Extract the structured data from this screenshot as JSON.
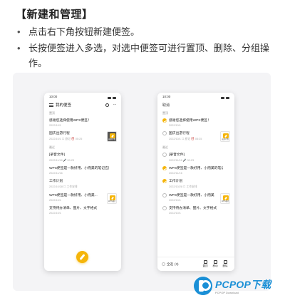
{
  "heading": "【新建和管理】",
  "bullets": [
    "点击右下角按钮新建便签。",
    "长按便签进入多选，对选中便签可进行置顶、删除、分组操作。"
  ],
  "phone_left": {
    "time": "10:00",
    "title": "我的便签",
    "sections": [
      "置顶",
      "最近"
    ],
    "notes": [
      {
        "title": "感谢您选择使用WPS便签！",
        "meta": "2022/10/1"
      },
      {
        "title": "国庆出游行程",
        "meta": "2022/10/1  ☐ 旅记  ⏰ 05:25",
        "thumb": "出游行程"
      },
      {
        "title": "[录音文件]",
        "meta": "2022/11/16  🎤 00:23"
      },
      {
        "title": "WPS便签是一款好用、小而美的笔记应用",
        "meta": "2022/11/16"
      },
      {
        "title": "工作计划",
        "meta": "2022/10/28  ☐ 工作安排"
      },
      {
        "title": "WPS便签是一款好用、小而美...",
        "meta": "2022/10/1",
        "thumb": "WPS便签"
      },
      {
        "title": "支持待办清单、图片、文字格式",
        "meta": "2022/10/1"
      }
    ]
  },
  "phone_right": {
    "time": "10:00",
    "cancel": "取消",
    "sections": [
      "置顶",
      "最近"
    ],
    "notes": [
      {
        "title": "感谢您选择使用WPS便签！",
        "meta": "2022/10/1",
        "checked": true
      },
      {
        "title": "国庆出游行程",
        "meta": "2022/10/1  ☐ 旅记  ⏰ 05:25",
        "checked": false,
        "thumb": "出游行程"
      },
      {
        "title": "[录音文件]",
        "meta": "2022/11/16  🎤 00:23",
        "checked": false
      },
      {
        "title": "WPS便签是一款好用、小而美的笔记...",
        "meta": "2022/11/16",
        "checked": true
      },
      {
        "title": "工作计划",
        "meta": "2022/10/28  ☐ 工作安排",
        "checked": true
      },
      {
        "title": "WPS便签是一款好用、小而美...",
        "meta": "2022/10/1",
        "checked": false,
        "thumb": "WPS便签"
      },
      {
        "title": "支持待办清单、图片、文字格式",
        "meta": "2022/10/1",
        "checked": false
      }
    ],
    "select_all": "全选",
    "selected_count": "(3)",
    "actions": [
      "置顶",
      "移动",
      "删除"
    ]
  },
  "logo": {
    "brand": "PCPOP下载",
    "sub": "PCPOP Download"
  },
  "colors": {
    "accent": "#f5b50a",
    "logo_blue": "#1a8fd6",
    "panel": "#f4f4f6"
  }
}
